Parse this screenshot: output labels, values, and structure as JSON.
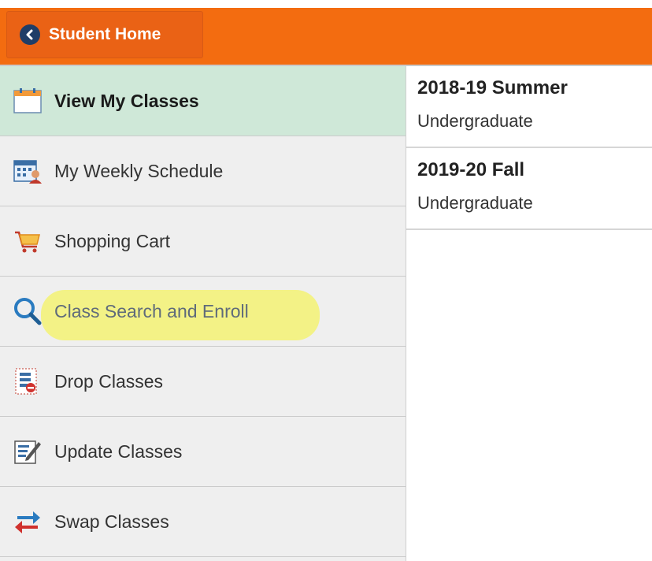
{
  "header": {
    "home_button_label": "Student Home",
    "accent_color": "#f36c10"
  },
  "sidebar": {
    "items": [
      {
        "label": "View My Classes",
        "icon": "calendar-icon",
        "active": true
      },
      {
        "label": "My Weekly Schedule",
        "icon": "weekly-schedule-icon",
        "active": false
      },
      {
        "label": "Shopping Cart",
        "icon": "shopping-cart-icon",
        "active": false
      },
      {
        "label": "Class Search and Enroll",
        "icon": "search-icon",
        "active": false,
        "highlighted": true
      },
      {
        "label": "Drop Classes",
        "icon": "drop-classes-icon",
        "active": false
      },
      {
        "label": "Update Classes",
        "icon": "edit-icon",
        "active": false
      },
      {
        "label": "Swap Classes",
        "icon": "swap-icon",
        "active": false
      }
    ]
  },
  "terms": [
    {
      "name": "2018-19 Summer",
      "career": "Undergraduate"
    },
    {
      "name": "2019-20 Fall",
      "career": "Undergraduate"
    }
  ]
}
